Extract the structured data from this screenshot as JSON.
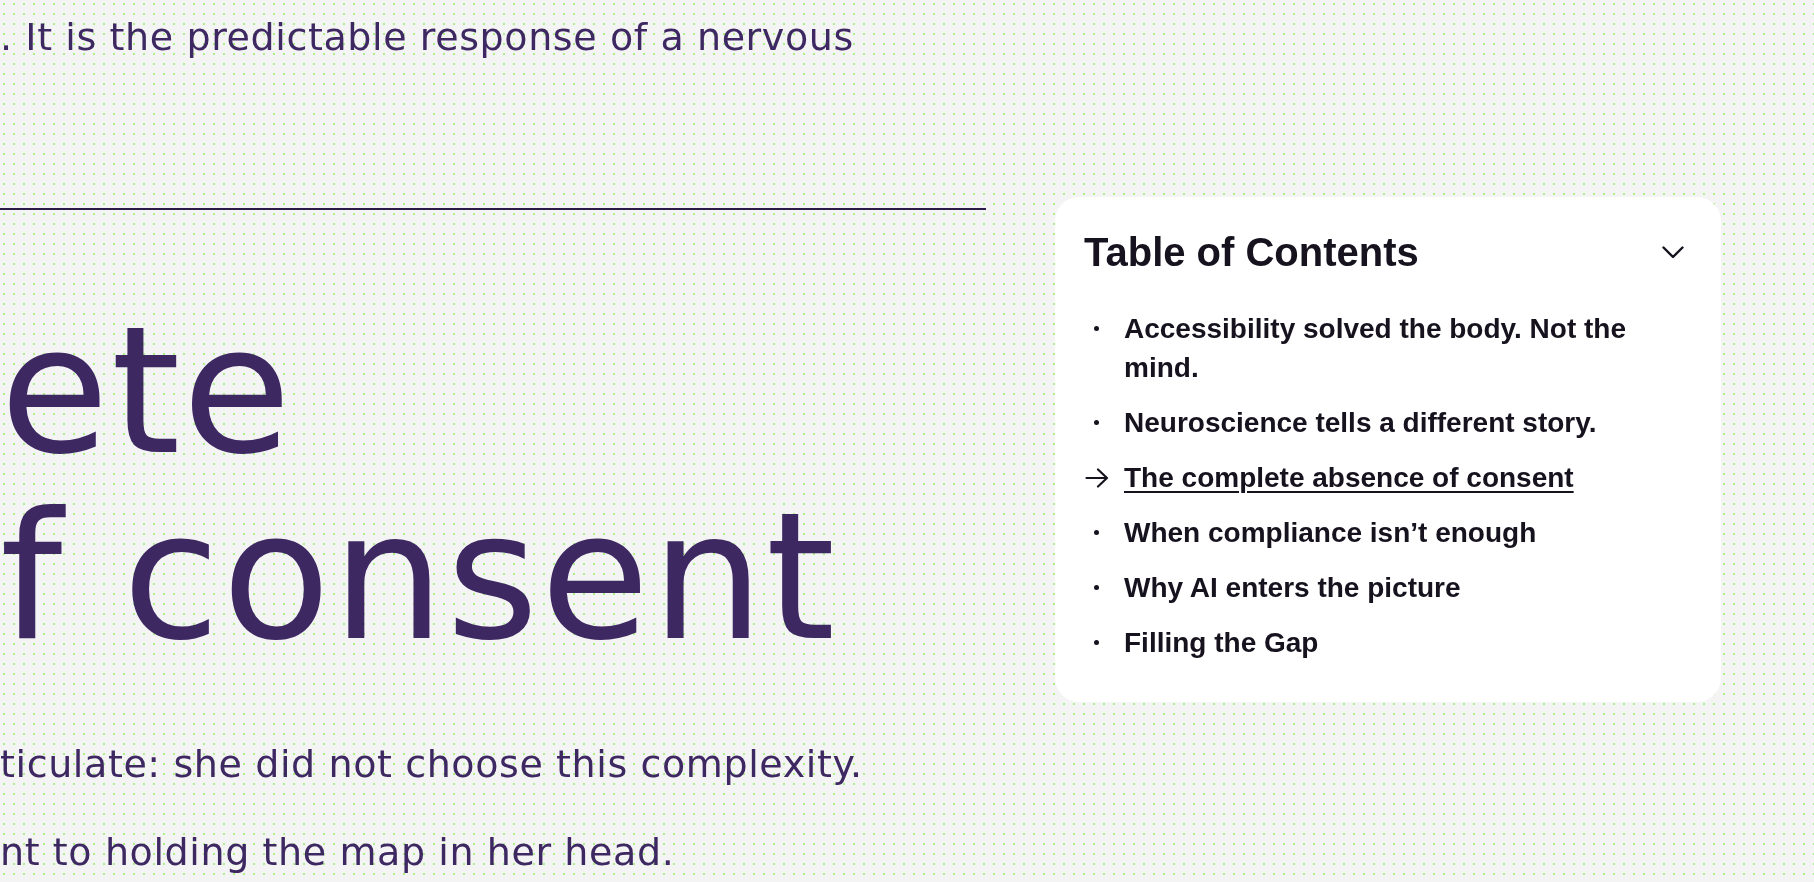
{
  "article": {
    "text_before": ". It is the predictable response of a nervous",
    "heading_lines": [
      "ete",
      "f consent"
    ],
    "paragraphs": [
      "ticulate: she did not choose this complexity.",
      "nt to holding the map in her head."
    ]
  },
  "toc": {
    "title": "Table of Contents",
    "expanded": true,
    "items": [
      {
        "label": "Accessibility solved the body. Not the mind.",
        "selected": false
      },
      {
        "label": "Neuroscience tells a different story.",
        "selected": false
      },
      {
        "label": "The complete absence of consent",
        "selected": true
      },
      {
        "label": "When compliance isn’t enough",
        "selected": false
      },
      {
        "label": "Why AI enters the picture",
        "selected": false
      },
      {
        "label": "Filling the Gap",
        "selected": false
      }
    ]
  }
}
